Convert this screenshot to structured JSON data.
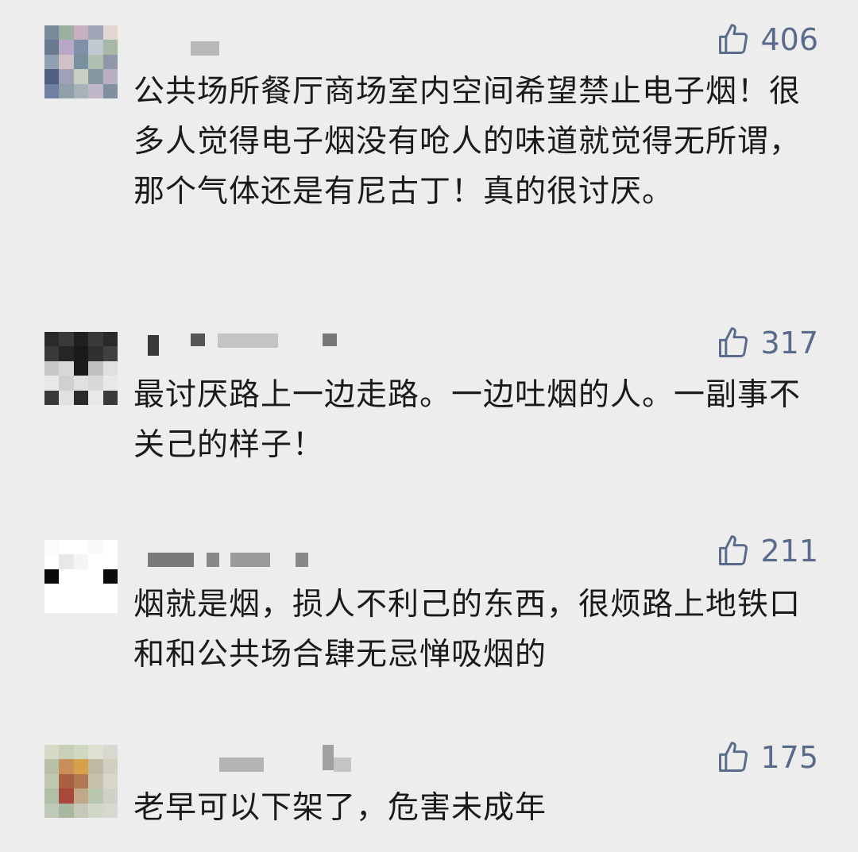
{
  "comments": [
    {
      "likes": "406",
      "text": "公共场所餐厅商场室内空间希望禁止电子烟！很多人觉得电子烟没有呛人的味道就觉得无所谓，那个气体还是有尼古丁！真的很讨厌。"
    },
    {
      "likes": "317",
      "text": "最讨厌路上一边走路。一边吐烟的人。一副事不关己的样子！"
    },
    {
      "likes": "211",
      "text": "烟就是烟，损人不利己的东西，很烦路上地铁口和和公共场合肆无忌惮吸烟的"
    },
    {
      "likes": "175",
      "text": "老早可以下架了，危害未成年"
    }
  ],
  "colors": {
    "background": "#ededed",
    "like_color": "#5a6a8a",
    "text_color": "#1a1a1a"
  },
  "icons": {
    "like": "thumbs-up-icon"
  }
}
